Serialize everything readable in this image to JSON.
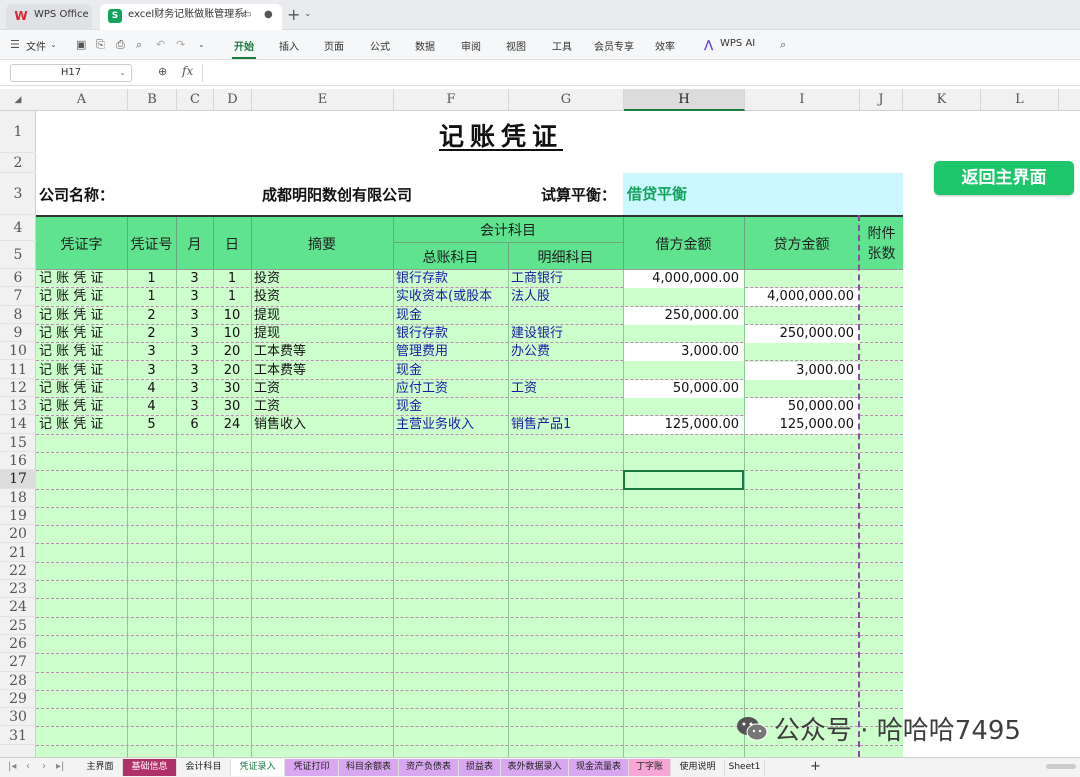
{
  "titlebar": {
    "app_tab": "WPS Office",
    "file_tab": "excel财务记账做账管理系统"
  },
  "menubar": {
    "file_menu": "文件",
    "tabs": [
      "开始",
      "插入",
      "页面",
      "公式",
      "数据",
      "审阅",
      "视图",
      "工具",
      "会员专享",
      "效率"
    ],
    "active_tab": "开始",
    "wps_ai": "WPS AI"
  },
  "formula_bar": {
    "name_box": "H17",
    "fx": "fx",
    "content": ""
  },
  "grid": {
    "columns": [
      "A",
      "B",
      "C",
      "D",
      "E",
      "F",
      "G",
      "H",
      "I",
      "J",
      "K",
      "L"
    ],
    "selected_column": "H",
    "rows": [
      "1",
      "2",
      "3",
      "4",
      "5",
      "6",
      "7",
      "8",
      "9",
      "10",
      "11",
      "12",
      "13",
      "14",
      "15",
      "16",
      "17",
      "18",
      "19",
      "20",
      "21",
      "22",
      "23",
      "24",
      "25",
      "26",
      "27",
      "28",
      "29",
      "30",
      "31"
    ],
    "selected_row": "17"
  },
  "voucher": {
    "title": "记账凭证",
    "company_label": "公司名称：",
    "company_name": "成都明阳数创有限公司",
    "balance_label": "试算平衡：",
    "balance_value": "借贷平衡",
    "back_button": "返回主界面",
    "headers": {
      "voucher_word": "凭证字",
      "voucher_no": "凭证号",
      "month": "月",
      "day": "日",
      "summary": "摘要",
      "accounting_subject": "会计科目",
      "general_ledger": "总账科目",
      "detail_subject": "明细科目",
      "debit": "借方金额",
      "credit": "贷方金额",
      "attachments": "附件张数"
    },
    "entries": [
      {
        "word": "记 账 凭 证",
        "no": "1",
        "month": "3",
        "day": "1",
        "summary": "投资",
        "ledger": "银行存款",
        "detail": "工商银行",
        "debit": "4,000,000.00",
        "credit": ""
      },
      {
        "word": "记 账 凭 证",
        "no": "1",
        "month": "3",
        "day": "1",
        "summary": "投资",
        "ledger": "实收资本(或股本",
        "detail": "法人股",
        "debit": "",
        "credit": "4,000,000.00"
      },
      {
        "word": "记 账 凭 证",
        "no": "2",
        "month": "3",
        "day": "10",
        "summary": "提现",
        "ledger": "现金",
        "detail": "",
        "debit": "250,000.00",
        "credit": ""
      },
      {
        "word": "记 账 凭 证",
        "no": "2",
        "month": "3",
        "day": "10",
        "summary": "提现",
        "ledger": "银行存款",
        "detail": "建设银行",
        "debit": "",
        "credit": "250,000.00"
      },
      {
        "word": "记 账 凭 证",
        "no": "3",
        "month": "3",
        "day": "20",
        "summary": "工本费等",
        "ledger": "管理费用",
        "detail": "办公费",
        "debit": "3,000.00",
        "credit": ""
      },
      {
        "word": "记 账 凭 证",
        "no": "3",
        "month": "3",
        "day": "20",
        "summary": "工本费等",
        "ledger": "现金",
        "detail": "",
        "debit": "",
        "credit": "3,000.00"
      },
      {
        "word": "记 账 凭 证",
        "no": "4",
        "month": "3",
        "day": "30",
        "summary": "工资",
        "ledger": "应付工资",
        "detail": "工资",
        "debit": "50,000.00",
        "credit": ""
      },
      {
        "word": "记 账 凭 证",
        "no": "4",
        "month": "3",
        "day": "30",
        "summary": "工资",
        "ledger": "现金",
        "detail": "",
        "debit": "",
        "credit": "50,000.00"
      },
      {
        "word": "记 账 凭 证",
        "no": "5",
        "month": "6",
        "day": "24",
        "summary": "销售收入",
        "ledger": "主营业务收入",
        "detail": "销售产品1",
        "debit": "125,000.00",
        "credit": "125,000.00"
      }
    ]
  },
  "sheet_tabs": [
    {
      "label": "主界面",
      "color": "#f3f3f3",
      "text": "#222"
    },
    {
      "label": "基础信息",
      "color": "#b0306a",
      "text": "#ffffff"
    },
    {
      "label": "会计科目",
      "color": "#f3f3f3",
      "text": "#222"
    },
    {
      "label": "凭证录入",
      "color": "#ffffff",
      "text": "#1a7a3e"
    },
    {
      "label": "凭证打印",
      "color": "#d9a6f0",
      "text": "#222"
    },
    {
      "label": "科目余额表",
      "color": "#d9a6f0",
      "text": "#222"
    },
    {
      "label": "资产负债表",
      "color": "#d9a6f0",
      "text": "#222"
    },
    {
      "label": "损益表",
      "color": "#d9a6f0",
      "text": "#222"
    },
    {
      "label": "表外数据录入",
      "color": "#d9a6f0",
      "text": "#222"
    },
    {
      "label": "现金流量表",
      "color": "#d9a6f0",
      "text": "#222"
    },
    {
      "label": "丁字账",
      "color": "#f7a6d6",
      "text": "#222"
    },
    {
      "label": "使用说明",
      "color": "#f3f3f3",
      "text": "#222"
    },
    {
      "label": "Sheet1",
      "color": "#f3f3f3",
      "text": "#222"
    }
  ],
  "watermark": {
    "text": "公众号 · 哈哈哈7495"
  },
  "colors": {
    "header_green": "#5fe38e",
    "body_green": "#ccffcc",
    "balance_cyan": "#ccf7ff",
    "button_green": "#1ec66b",
    "accent": "#1a7a3e"
  }
}
